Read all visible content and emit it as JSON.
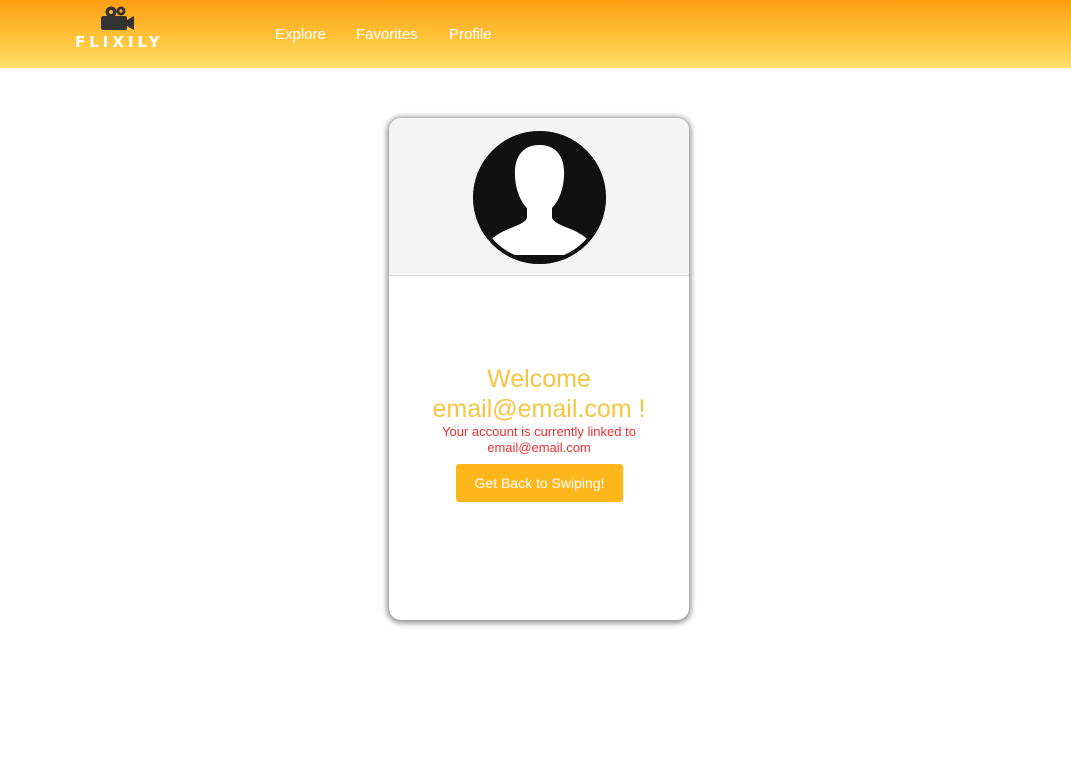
{
  "brand": {
    "name": "FLIXILY",
    "logo_icon": "movie-camera-icon"
  },
  "nav": {
    "links": [
      {
        "label": "Explore"
      },
      {
        "label": "Favorites"
      },
      {
        "label": "Profile"
      }
    ]
  },
  "profile": {
    "avatar_icon": "default-user-silhouette-icon",
    "welcome_line1": "Welcome",
    "welcome_line2": "email@email.com !",
    "linked_line1": "Your account is currently linked to",
    "linked_line2": "email@email.com",
    "cta_label": "Get Back to Swiping!"
  },
  "colors": {
    "navbar_top": "#ff9f12",
    "navbar_bottom": "#ffdf6a",
    "welcome_text": "#f5c542",
    "linked_text": "#ea2f2f",
    "button_bg": "#ffb61a"
  }
}
